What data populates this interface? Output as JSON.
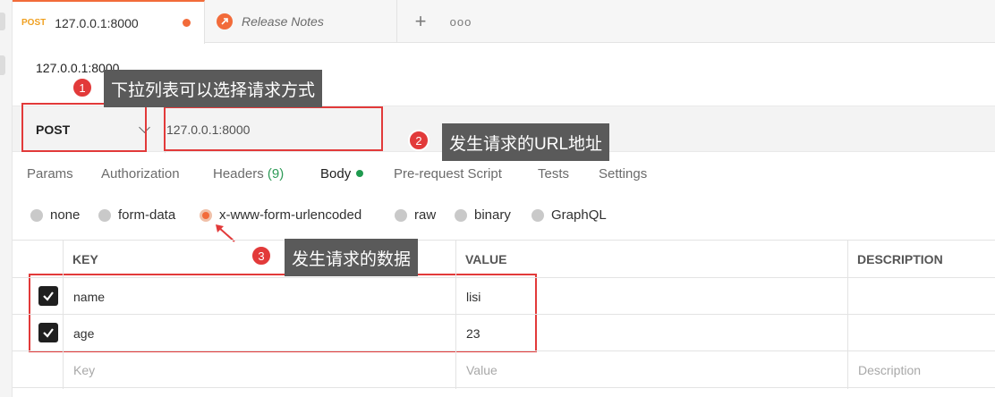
{
  "tabs": {
    "active": {
      "method": "POST",
      "url": "127.0.0.1:8000"
    },
    "release": {
      "label": "Release Notes"
    },
    "plus": "+",
    "more": "ooo"
  },
  "request": {
    "name": "127.0.0.1:8000",
    "method": "POST",
    "url": "127.0.0.1:8000"
  },
  "subtabs": {
    "params": "Params",
    "authorization": "Authorization",
    "headers": "Headers",
    "headers_count": "(9)",
    "body": "Body",
    "prerequest": "Pre-request Script",
    "tests": "Tests",
    "settings": "Settings"
  },
  "body_types": {
    "none": "none",
    "form_data": "form-data",
    "urlencoded": "x-www-form-urlencoded",
    "raw": "raw",
    "binary": "binary",
    "graphql": "GraphQL",
    "selected": "x-www-form-urlencoded"
  },
  "table": {
    "headers": {
      "key": "KEY",
      "value": "VALUE",
      "description": "DESCRIPTION"
    },
    "rows": [
      {
        "key": "name",
        "value": "lisi",
        "checked": true
      },
      {
        "key": "age",
        "value": "23",
        "checked": true
      }
    ],
    "placeholder": {
      "key": "Key",
      "value": "Value",
      "description": "Description"
    }
  },
  "annotations": [
    {
      "num": "1",
      "text": "下拉列表可以选择请求方式"
    },
    {
      "num": "2",
      "text": "发生请求的URL地址"
    },
    {
      "num": "3",
      "text": "发生请求的数据"
    }
  ],
  "colors": {
    "accent": "#f26b3a",
    "annotation_red": "#e23a3a",
    "annotation_bg": "#5a5a5a",
    "body_dot": "#1f9a4f"
  }
}
